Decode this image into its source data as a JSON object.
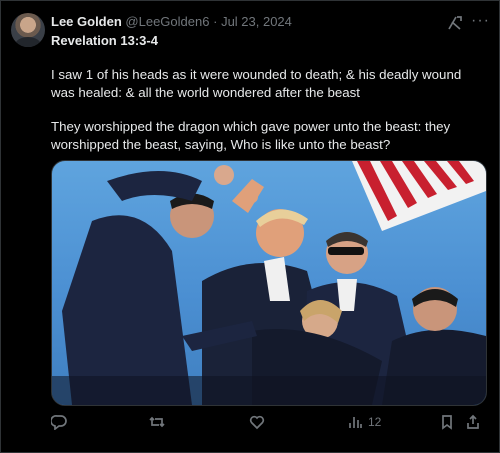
{
  "tweet": {
    "author_name": "Lee Golden",
    "handle": "@LeeGolden6",
    "separator": "·",
    "date": "Jul 23, 2024",
    "reference": "Revelation 13:3-4",
    "paragraphs": [
      "I saw 1 of his heads as it were wounded to death; & his deadly wound was healed: & all the world wondered after the beast",
      "They worshipped the dragon which gave power unto the beast: they worshipped the beast, saying, Who is like unto the beast?"
    ]
  },
  "actions": {
    "views_count": "12"
  },
  "icons": {
    "avatar": "profile-photo",
    "grok": "grok-icon",
    "more": "more-dots-icon",
    "reply": "reply-icon",
    "retweet": "retweet-icon",
    "like": "heart-icon",
    "views": "views-bar-icon",
    "bookmark": "bookmark-icon",
    "share": "share-icon"
  },
  "colors": {
    "background": "#000000",
    "text": "#e7e9ea",
    "muted": "#71767b",
    "border": "#2f3336"
  }
}
